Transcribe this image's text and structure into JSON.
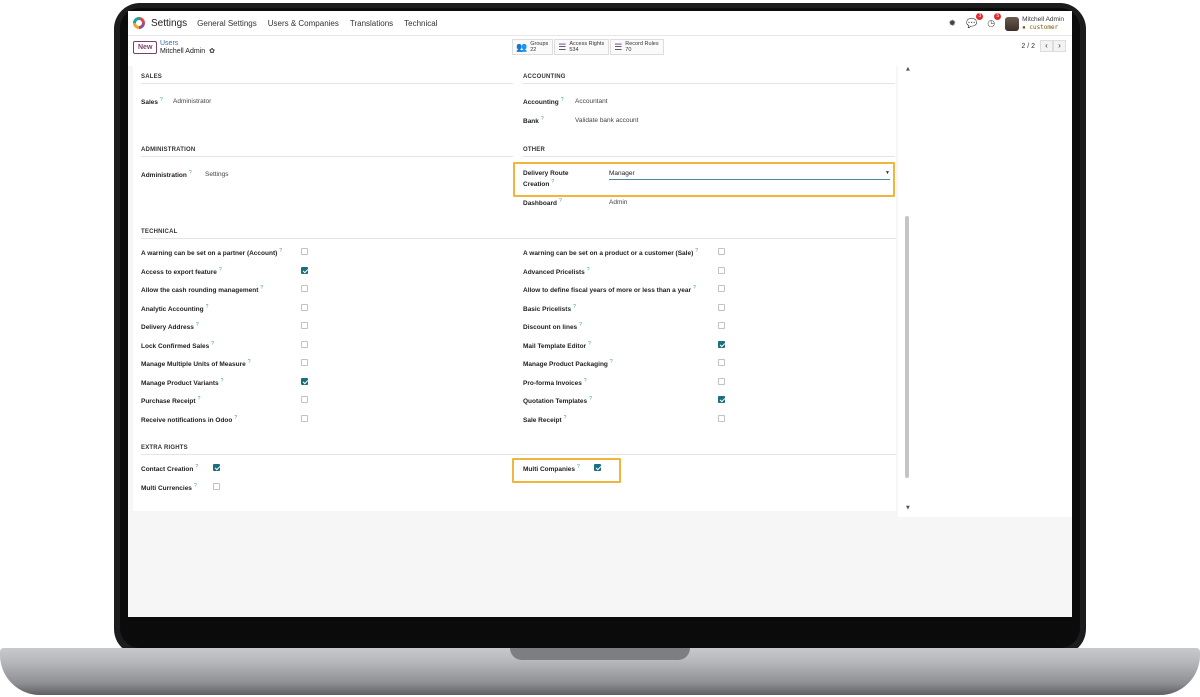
{
  "topnav": {
    "app_title": "Settings",
    "menu": [
      "General Settings",
      "Users & Companies",
      "Translations",
      "Technical"
    ],
    "chat_badge": "3",
    "activity_badge": "5",
    "user_name": "Mitchell Admin",
    "db_name": "customer"
  },
  "control": {
    "new_label": "New",
    "breadcrumb_parent": "Users",
    "breadcrumb_current": "Mitchell Admin",
    "smart": [
      {
        "label": "Groups",
        "count": "22"
      },
      {
        "label": "Access Rights",
        "count": "534"
      },
      {
        "label": "Record Rules",
        "count": "70"
      }
    ],
    "pager": "2 / 2"
  },
  "sections": {
    "sales": "SALES",
    "accounting": "ACCOUNTING",
    "administration": "ADMINISTRATION",
    "other": "OTHER",
    "technical": "TECHNICAL",
    "extra": "EXTRA RIGHTS"
  },
  "fields": {
    "sales_label": "Sales",
    "sales_value": "Administrator",
    "accounting_label": "Accounting",
    "accounting_value": "Accountant",
    "bank_label": "Bank",
    "bank_value": "Validate bank account",
    "admin_label": "Administration",
    "admin_value": "Settings",
    "delivery_label_1": "Delivery Route",
    "delivery_label_2": "Creation",
    "delivery_value": "Manager",
    "dashboard_label": "Dashboard",
    "dashboard_value": "Admin"
  },
  "technical_left": [
    {
      "label": "A warning can be set on a partner (Account)",
      "checked": false
    },
    {
      "label": "Access to export feature",
      "checked": true
    },
    {
      "label": "Allow the cash rounding management",
      "checked": false
    },
    {
      "label": "Analytic Accounting",
      "checked": false
    },
    {
      "label": "Delivery Address",
      "checked": false
    },
    {
      "label": "Lock Confirmed Sales",
      "checked": false
    },
    {
      "label": "Manage Multiple Units of Measure",
      "checked": false
    },
    {
      "label": "Manage Product Variants",
      "checked": true
    },
    {
      "label": "Purchase Receipt",
      "checked": false
    },
    {
      "label": "Receive notifications in Odoo",
      "checked": false
    }
  ],
  "technical_right": [
    {
      "label": "A warning can be set on a product or a customer (Sale)",
      "checked": false
    },
    {
      "label": "Advanced Pricelists",
      "checked": false
    },
    {
      "label": "Allow to define fiscal years of more or less than a year",
      "checked": false
    },
    {
      "label": "Basic Pricelists",
      "checked": false
    },
    {
      "label": "Discount on lines",
      "checked": false
    },
    {
      "label": "Mail Template Editor",
      "checked": true
    },
    {
      "label": "Manage Product Packaging",
      "checked": false
    },
    {
      "label": "Pro-forma Invoices",
      "checked": false
    },
    {
      "label": "Quotation Templates",
      "checked": true
    },
    {
      "label": "Sale Receipt",
      "checked": false
    }
  ],
  "extra_left": [
    {
      "label": "Contact Creation",
      "checked": true
    },
    {
      "label": "Multi Currencies",
      "checked": false
    }
  ],
  "extra_right": [
    {
      "label": "Multi Companies",
      "checked": true
    }
  ],
  "colors": {
    "accent": "#1a6f7f",
    "highlight": "#f2b53c",
    "brand": "#7b3f6e"
  }
}
